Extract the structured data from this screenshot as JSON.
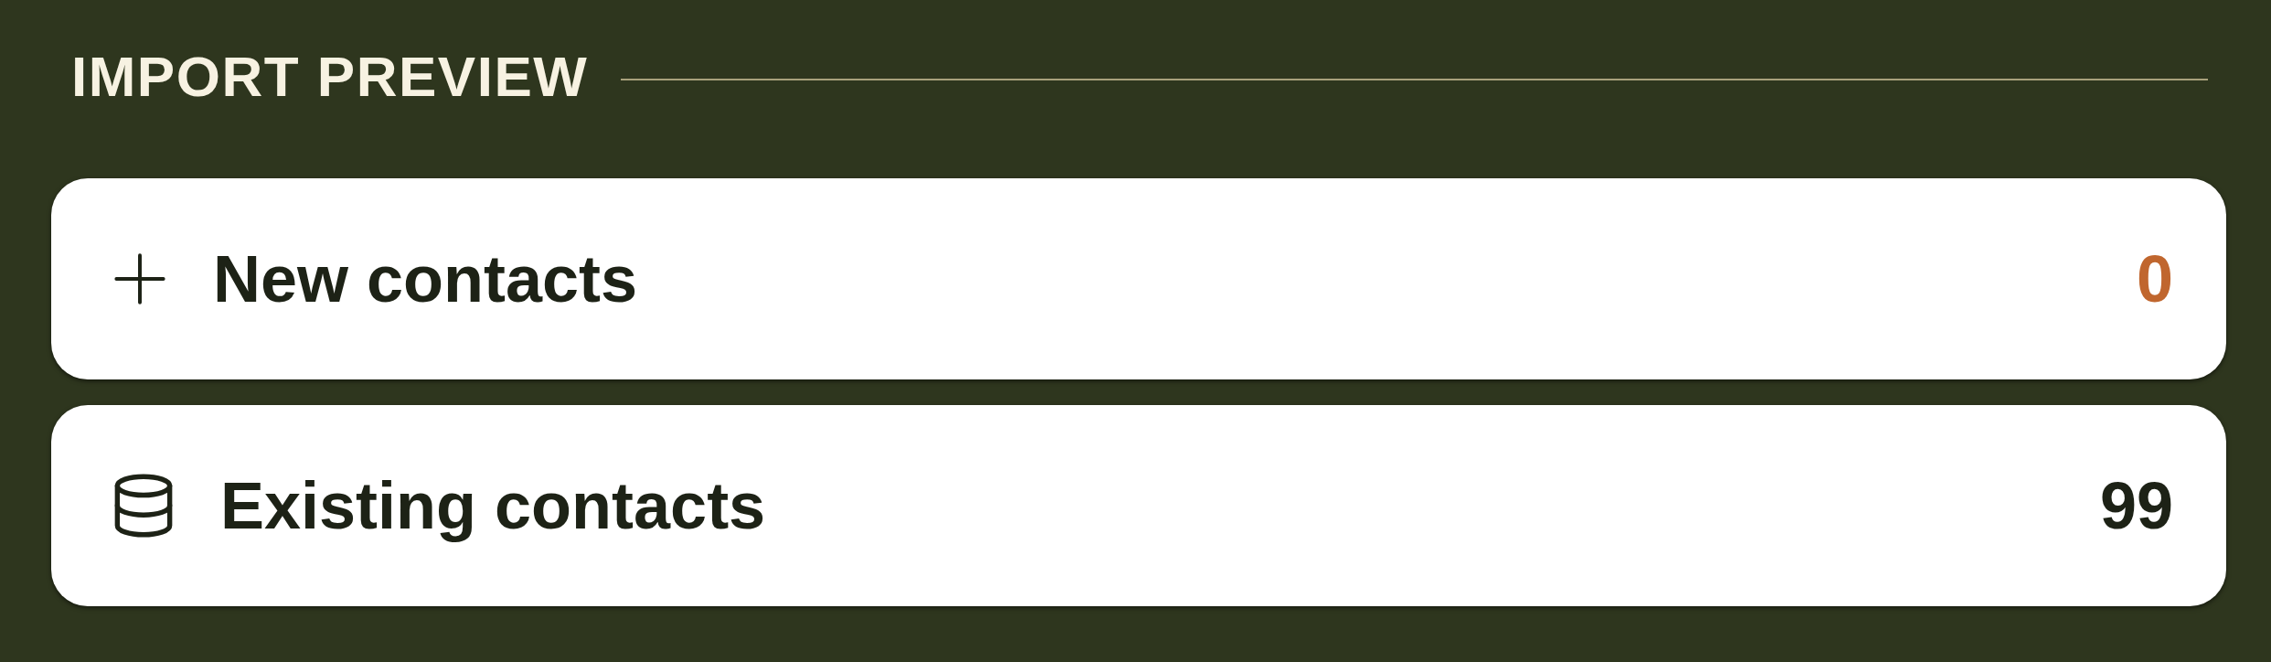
{
  "section": {
    "title": "IMPORT PREVIEW"
  },
  "rows": [
    {
      "kind": "new",
      "label": "New contacts",
      "count": "0",
      "color": "#c0662e"
    },
    {
      "kind": "existing",
      "label": "Existing contacts",
      "count": "99",
      "color": "#1d2216"
    }
  ]
}
